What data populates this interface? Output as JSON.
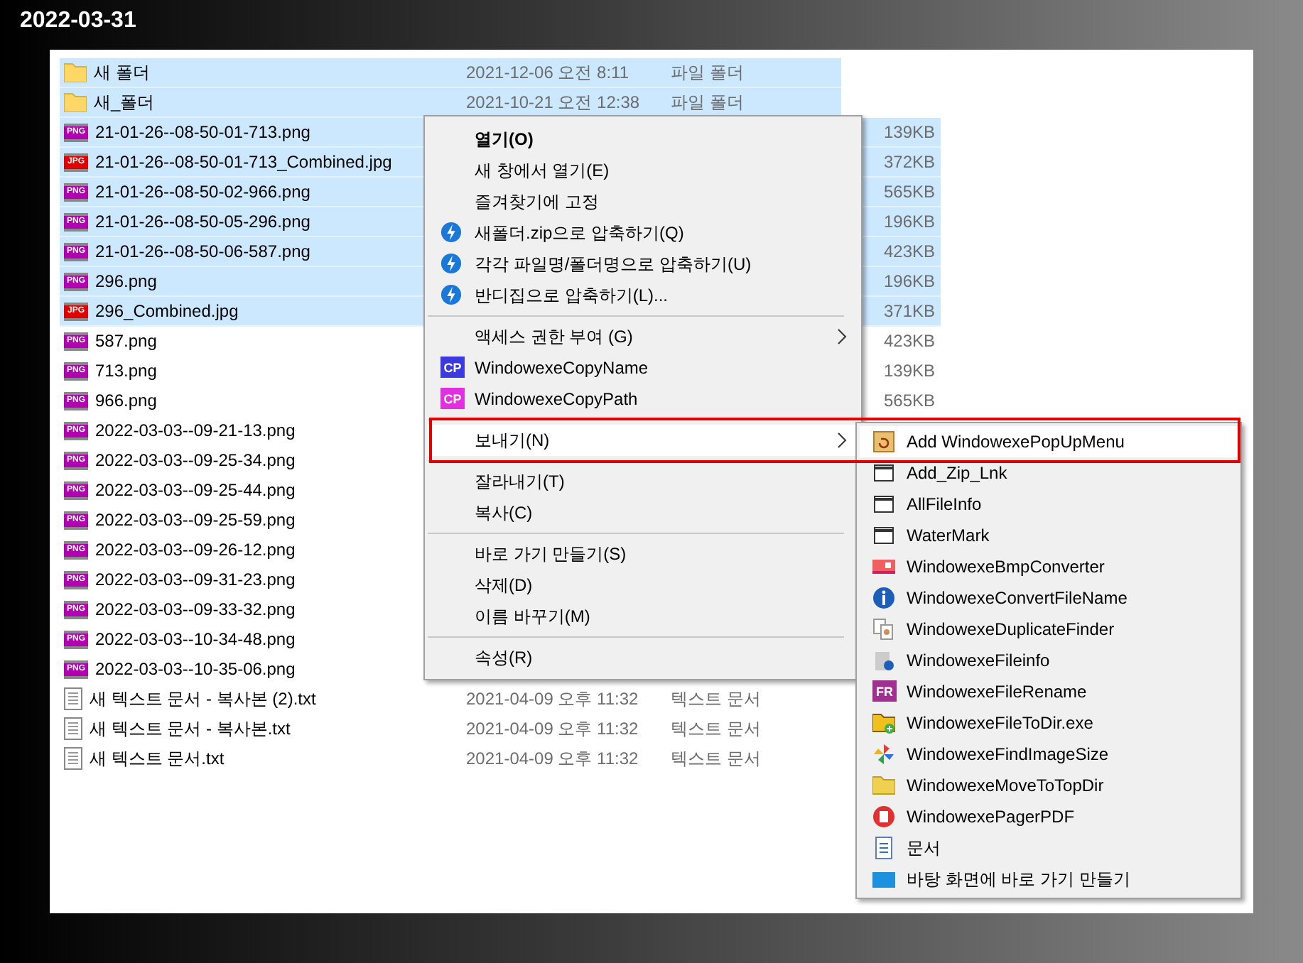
{
  "title": "2022-03-31",
  "files": [
    {
      "name": "새 폴더",
      "kind": "folder",
      "date": "2021-12-06 오전 8:11",
      "type": "파일 폴더",
      "selected": true
    },
    {
      "name": "새_폴더",
      "kind": "folder",
      "date": "2021-10-21 오전 12:38",
      "type": "파일 폴더",
      "selected": true
    },
    {
      "name": "21-01-26--08-50-01-713.png",
      "kind": "png",
      "badge": "PNG",
      "size": "139KB",
      "selected": true
    },
    {
      "name": "21-01-26--08-50-01-713_Combined.jpg",
      "kind": "jpg",
      "badge": "JPG",
      "size": "372KB",
      "selected": true
    },
    {
      "name": "21-01-26--08-50-02-966.png",
      "kind": "png",
      "badge": "PNG",
      "size": "565KB",
      "selected": true
    },
    {
      "name": "21-01-26--08-50-05-296.png",
      "kind": "png",
      "badge": "PNG",
      "size": "196KB",
      "selected": true
    },
    {
      "name": "21-01-26--08-50-06-587.png",
      "kind": "png",
      "badge": "PNG",
      "size": "423KB",
      "selected": true
    },
    {
      "name": "296.png",
      "kind": "png",
      "badge": "PNG",
      "size": "196KB",
      "selected": true
    },
    {
      "name": "296_Combined.jpg",
      "kind": "jpg",
      "badge": "JPG",
      "size": "371KB",
      "selected": true
    },
    {
      "name": "587.png",
      "kind": "png",
      "badge": "PNG",
      "size": "423KB",
      "selected": false
    },
    {
      "name": "713.png",
      "kind": "png",
      "badge": "PNG",
      "size": "139KB",
      "selected": false
    },
    {
      "name": "966.png",
      "kind": "png",
      "badge": "PNG",
      "size": "565KB",
      "selected": false
    },
    {
      "name": "2022-03-03--09-21-13.png",
      "kind": "png",
      "badge": "PNG",
      "selected": false
    },
    {
      "name": "2022-03-03--09-25-34.png",
      "kind": "png",
      "badge": "PNG",
      "selected": false
    },
    {
      "name": "2022-03-03--09-25-44.png",
      "kind": "png",
      "badge": "PNG",
      "selected": false
    },
    {
      "name": "2022-03-03--09-25-59.png",
      "kind": "png",
      "badge": "PNG",
      "selected": false
    },
    {
      "name": "2022-03-03--09-26-12.png",
      "kind": "png",
      "badge": "PNG",
      "selected": false
    },
    {
      "name": "2022-03-03--09-31-23.png",
      "kind": "png",
      "badge": "PNG",
      "selected": false
    },
    {
      "name": "2022-03-03--09-33-32.png",
      "kind": "png",
      "badge": "PNG",
      "selected": false
    },
    {
      "name": "2022-03-03--10-34-48.png",
      "kind": "png",
      "badge": "PNG",
      "selected": false
    },
    {
      "name": "2022-03-03--10-35-06.png",
      "kind": "png",
      "badge": "PNG",
      "selected": false
    },
    {
      "name": "새 텍스트 문서 - 복사본 (2).txt",
      "kind": "txt",
      "date": "2021-04-09 오후 11:32",
      "type": "텍스트 문서",
      "selected": false
    },
    {
      "name": "새 텍스트 문서 - 복사본.txt",
      "kind": "txt",
      "date": "2021-04-09 오후 11:32",
      "type": "텍스트 문서",
      "selected": false
    },
    {
      "name": "새 텍스트 문서.txt",
      "kind": "txt",
      "date": "2021-04-09 오후 11:32",
      "type": "텍스트 문서",
      "selected": false
    }
  ],
  "context_menu": {
    "items": [
      {
        "kind": "item",
        "label": "열기(O)",
        "bold": true
      },
      {
        "kind": "item",
        "label": "새 창에서 열기(E)"
      },
      {
        "kind": "item",
        "label": "즐겨찾기에 고정"
      },
      {
        "kind": "zip",
        "label": "새폴더.zip으로 압축하기(Q)"
      },
      {
        "kind": "zip",
        "label": "각각 파일명/폴더명으로 압축하기(U)"
      },
      {
        "kind": "zip",
        "label": "반디집으로 압축하기(L)..."
      },
      {
        "kind": "separator"
      },
      {
        "kind": "item",
        "label": "액세스 권한 부여 (G)",
        "submenu": true
      },
      {
        "kind": "cp",
        "label": "WindowexeCopyName",
        "badge": "CP",
        "color": "#3a3ae0"
      },
      {
        "kind": "cp",
        "label": "WindowexeCopyPath",
        "badge": "CP",
        "color": "#e030e0"
      },
      {
        "kind": "separator"
      },
      {
        "kind": "item",
        "label": "보내기(N)",
        "submenu": true,
        "boxed": true,
        "selected": true
      },
      {
        "kind": "separator"
      },
      {
        "kind": "item",
        "label": "잘라내기(T)"
      },
      {
        "kind": "item",
        "label": "복사(C)"
      },
      {
        "kind": "separator"
      },
      {
        "kind": "item",
        "label": "바로 가기 만들기(S)"
      },
      {
        "kind": "item",
        "label": "삭제(D)"
      },
      {
        "kind": "item",
        "label": "이름 바꾸기(M)"
      },
      {
        "kind": "separator"
      },
      {
        "kind": "item",
        "label": "속성(R)"
      }
    ]
  },
  "send_to_menu": {
    "items": [
      {
        "label": "Add WindowexePopUpMenu",
        "kind": "popup",
        "selected": true
      },
      {
        "label": "Add_Zip_Lnk",
        "kind": "window",
        "selected": false
      },
      {
        "label": "AllFileInfo",
        "kind": "window",
        "selected": false
      },
      {
        "label": "WaterMark",
        "kind": "window",
        "selected": false
      },
      {
        "label": "WindowexeBmpConverter",
        "kind": "bmp",
        "selected": false
      },
      {
        "label": "WindowexeConvertFileName",
        "kind": "info",
        "selected": false
      },
      {
        "label": "WindowexeDuplicateFinder",
        "kind": "duplicate",
        "selected": false
      },
      {
        "label": "WindowexeFileinfo",
        "kind": "fileinfo",
        "selected": false
      },
      {
        "label": "WindowexeFileRename",
        "kind": "fr",
        "badge": "FR",
        "selected": false
      },
      {
        "label": "WindowexeFileToDir.exe",
        "kind": "folderadd",
        "selected": false
      },
      {
        "label": "WindowexeFindImageSize",
        "kind": "pinwheel",
        "selected": false
      },
      {
        "label": "WindowexeMoveToTopDir",
        "kind": "folder",
        "selected": false
      },
      {
        "label": "WindowexePagerPDF",
        "kind": "pdf",
        "selected": false
      },
      {
        "label": "문서",
        "kind": "doc",
        "selected": false
      },
      {
        "label": "바탕 화면에 바로 가기 만들기",
        "kind": "desktop",
        "selected": false
      }
    ]
  }
}
